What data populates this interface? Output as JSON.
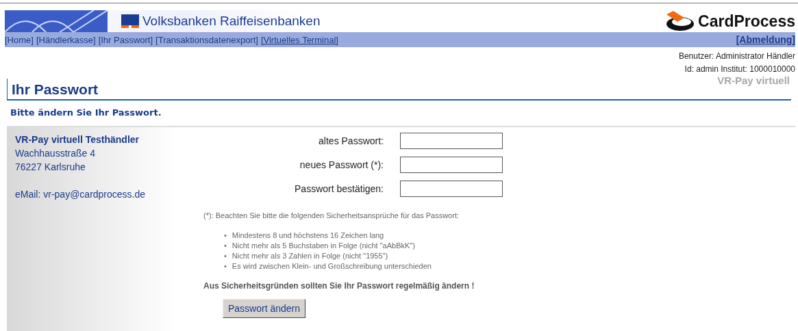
{
  "header": {
    "bank_name": "Volksbanken Raiffeisenbanken",
    "brand": "CardProcess"
  },
  "nav": {
    "links": [
      {
        "label": "[Home]",
        "underlined": false
      },
      {
        "label": "[Händlerkasse]",
        "underlined": false
      },
      {
        "label": "[Ihr Passwort]",
        "underlined": false
      },
      {
        "label": "[Transaktionsdatenexport]",
        "underlined": false
      },
      {
        "label": "[Virtuelles Terminal]",
        "underlined": true
      }
    ],
    "logout": "[Abmeldung]"
  },
  "user_info": {
    "user": "Benutzer: Administrator Händler",
    "id": "Id: admin Institut: 1000010000",
    "product": "VR-Pay virtuell"
  },
  "page_title": "Ihr Passwort",
  "subtitle": "Bitte ändern Sie Ihr Passwort.",
  "merchant": {
    "name": "VR-Pay virtuell Testhändler",
    "street": "Wachhausstraße 4",
    "city": "76227 Karlsruhe",
    "email": "eMail: vr-pay@cardprocess.de"
  },
  "form": {
    "fields": [
      {
        "label": "altes Passwort:"
      },
      {
        "label": "neues Passwort (*):"
      },
      {
        "label": "Passwort bestätigen:"
      }
    ],
    "note": "(*): Beachten Sie bitte die folgenden Sicherheitsansprüche für das Passwort:",
    "rules": [
      {
        "bullet": "•",
        "text": "Mindestens 8 und höchstens 16 Zeichen lang"
      },
      {
        "bullet": "•",
        "text": "Nicht mehr als 5 Buchstaben in Folge (nicht \"aAbBkK\")"
      },
      {
        "bullet": "•",
        "text": "Nicht mehr als 3 Zahlen in Folge (nicht \"1955\")"
      },
      {
        "bullet": "•",
        "text": "Es wird zwischen Klein- und Großschreibung unterschieden"
      }
    ],
    "warning": "Aus Sicherheitsgründen sollten Sie Ihr Passwort regelmäßig ändern !",
    "submit": "Passwort ändern"
  }
}
